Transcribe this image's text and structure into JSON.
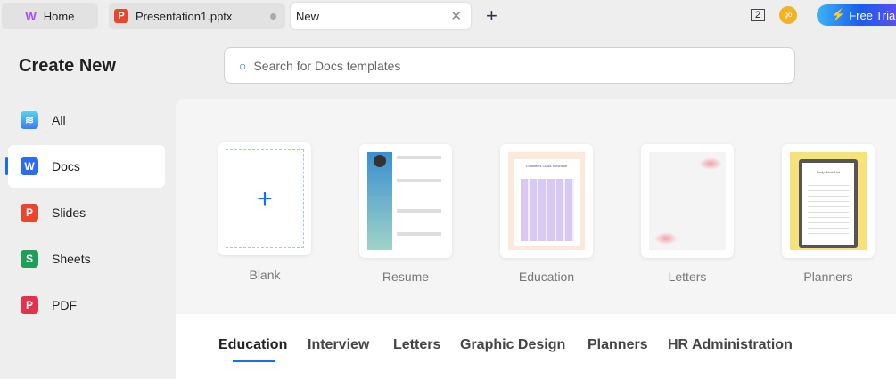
{
  "tabs": [
    {
      "label": "Home"
    },
    {
      "label": "Presentation1.pptx"
    },
    {
      "label": "New"
    }
  ],
  "topbar": {
    "badge": "2",
    "avatar": "go",
    "trial": "Free Trial"
  },
  "title": "Create New",
  "search": {
    "placeholder": "Search for Docs templates"
  },
  "sidebar": [
    {
      "label": "All"
    },
    {
      "label": "Docs"
    },
    {
      "label": "Slides"
    },
    {
      "label": "Sheets"
    },
    {
      "label": "PDF"
    }
  ],
  "templates": [
    {
      "label": "Blank"
    },
    {
      "label": "Resume"
    },
    {
      "label": "Education"
    },
    {
      "label": "Letters"
    },
    {
      "label": "Planners"
    }
  ],
  "thumb_text": {
    "edu": "Children's Class Schedule",
    "planner": "Daily Work List"
  },
  "categories": [
    "Education",
    "Interview",
    "Letters",
    "Graphic Design",
    "Planners",
    "HR Administration"
  ],
  "colors": {
    "accent": "#1a6cf0",
    "docs": "#2f6bf2",
    "slides": "#e8462f",
    "sheets": "#1f9e5a",
    "pdf": "#e0334d"
  }
}
